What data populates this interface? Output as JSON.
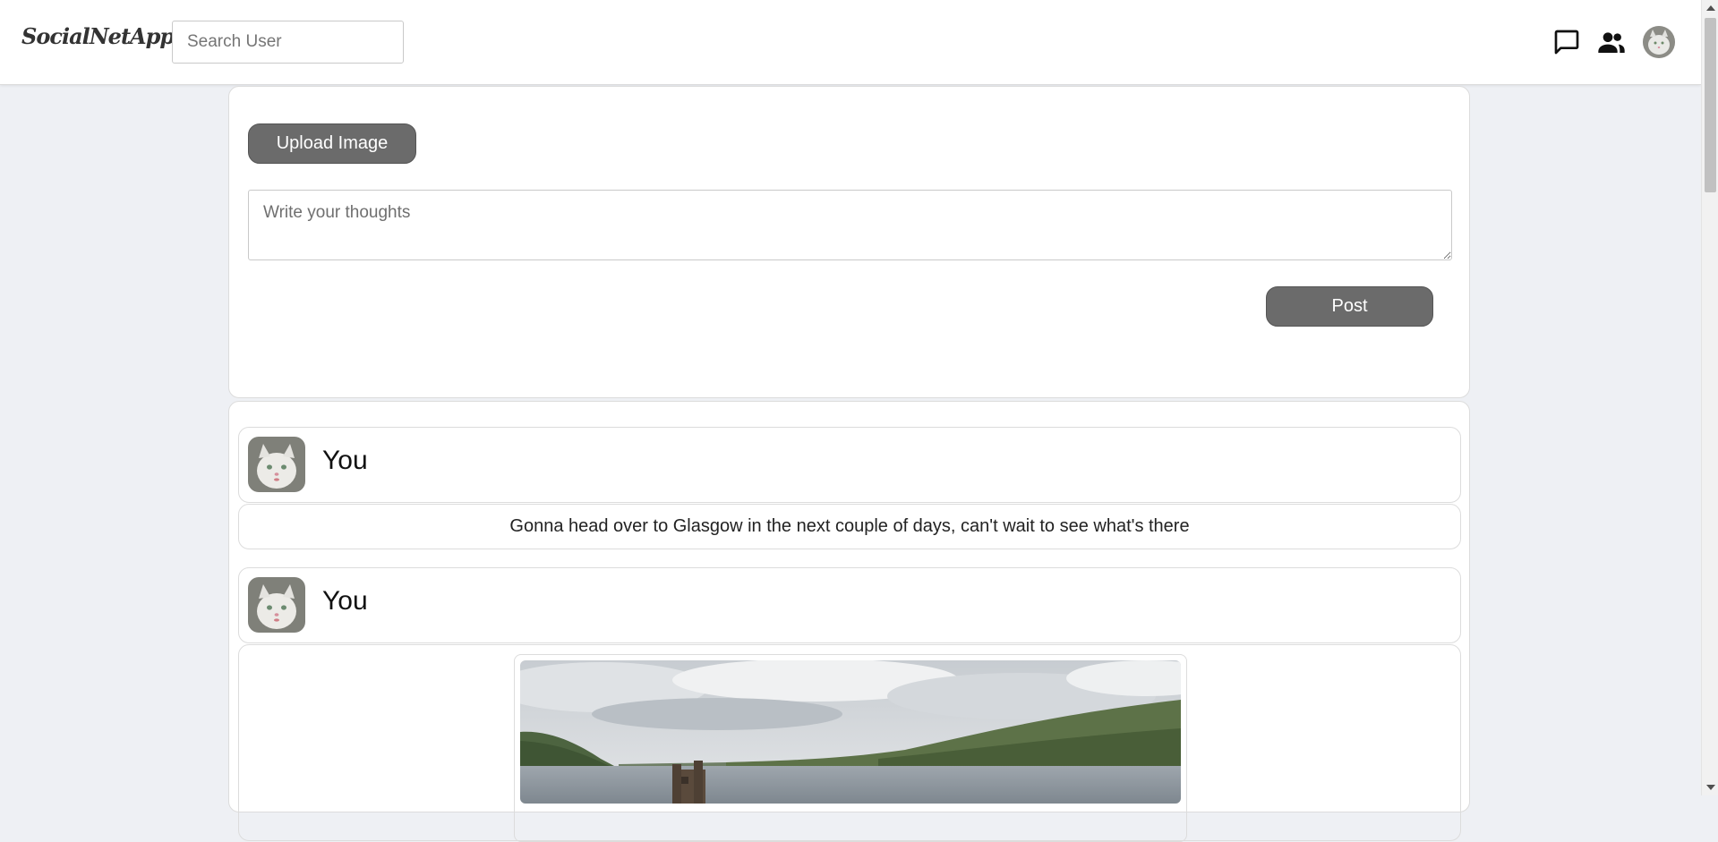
{
  "app": {
    "brand": "SocialNetApp"
  },
  "navbar": {
    "search_placeholder": "Search User",
    "icons": [
      "chat-icon",
      "friends-icon",
      "profile-avatar"
    ]
  },
  "composer": {
    "upload_label": "Upload Image",
    "thoughts_placeholder": "Write your thoughts",
    "post_label": "Post"
  },
  "feed": {
    "posts": [
      {
        "author": "You",
        "text": "Gonna head over to Glasgow in the next couple of days, can't wait to see what's there"
      },
      {
        "author": "You",
        "image": "castle-by-lake-photo"
      }
    ]
  },
  "colors": {
    "background": "#eef0f4",
    "button": "#6b6b6b",
    "card": "#ffffff",
    "border": "#dcdcdc"
  }
}
